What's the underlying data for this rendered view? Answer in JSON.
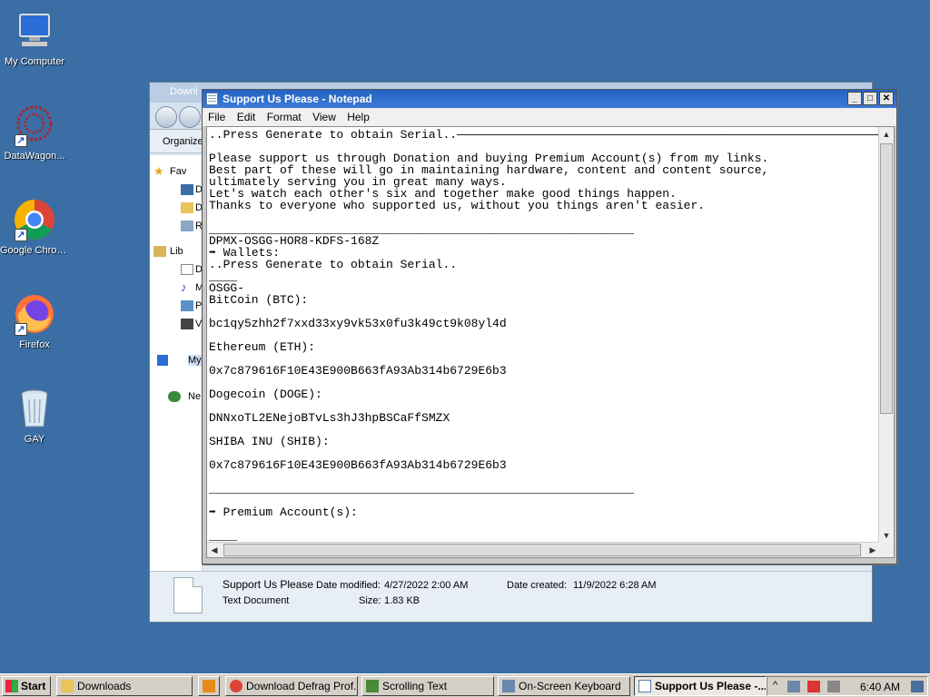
{
  "desktop": {
    "icons": [
      {
        "label": "My Computer"
      },
      {
        "label": "DataWagon..."
      },
      {
        "label": "Google Chrome"
      },
      {
        "label": "Firefox"
      },
      {
        "label": "GAY"
      }
    ],
    "shortcut_glyph": "↗"
  },
  "explorer": {
    "title": "Downl",
    "toolbar_label": "Organize",
    "nav": [
      "Fav",
      "D",
      "D",
      "R",
      "Lib",
      "D",
      "M",
      "P",
      "V",
      "My",
      "Ne"
    ],
    "details": {
      "name": "Support Us Please",
      "type": "Text Document",
      "modified_label": "Date modified:",
      "modified_value": "4/27/2022 2:00 AM",
      "created_label": "Date created:",
      "created_value": "11/9/2022 6:28 AM",
      "size_label": "Size:",
      "size_value": "1.83 KB"
    }
  },
  "notepad": {
    "title": "Support Us Please - Notepad",
    "menu": [
      "File",
      "Edit",
      "Format",
      "View",
      "Help"
    ],
    "window_buttons": {
      "minimize": "_",
      "maximize": "□",
      "close": "✕"
    },
    "lines": [
      "..Press Generate to obtain Serial..—————————————————————————————————————————————————————————————",
      "",
      "Please support us through Donation and buying Premium Account(s) from my links.",
      "Best part of these will go in maintaining hardware, content and content source,",
      "ultimately serving you in great many ways.",
      "Let's watch each other's six and together make good things happen.",
      "Thanks to everyone who supported us, without you things aren't easier.",
      "",
      "____________________________________________________________",
      "DPMX-OSGG-HOR8-KDFS-168Z",
      "➡ Wallets:",
      "..Press Generate to obtain Serial..",
      "____",
      "OSGG-",
      "BitCoin (BTC):",
      "",
      "bc1qy5zhh2f7xxd33xy9vk53x0fu3k49ct9k08yl4d",
      "",
      "Ethereum (ETH):",
      "",
      "0x7c879616F10E43E900B663fA93Ab314b6729E6b3",
      "",
      "Dogecoin (DOGE):",
      "",
      "DNNxoTL2ENejoBTvLs3hJ3hpBSCaFfSMZX",
      "",
      "SHIBA INU (SHIB):",
      "",
      "0x7c879616F10E43E900B663fA93Ab314b6729E6b3",
      "",
      "____________________________________________________________",
      "",
      "➡ Premium Account(s):",
      "",
      "____"
    ],
    "scroll_arrows": {
      "up": "▲",
      "down": "▼",
      "left": "◀",
      "right": "▶"
    }
  },
  "taskbar": {
    "start": "Start",
    "tasks": [
      "Downloads",
      "Download Defrag Prof...",
      "Scrolling Text",
      "On-Screen Keyboard",
      "Support Us Please -..."
    ],
    "clock": "6:40 AM",
    "tray_glyph": "^"
  },
  "colors": {
    "desktop": "#3a6ea5",
    "title_active": "#2463c4"
  }
}
